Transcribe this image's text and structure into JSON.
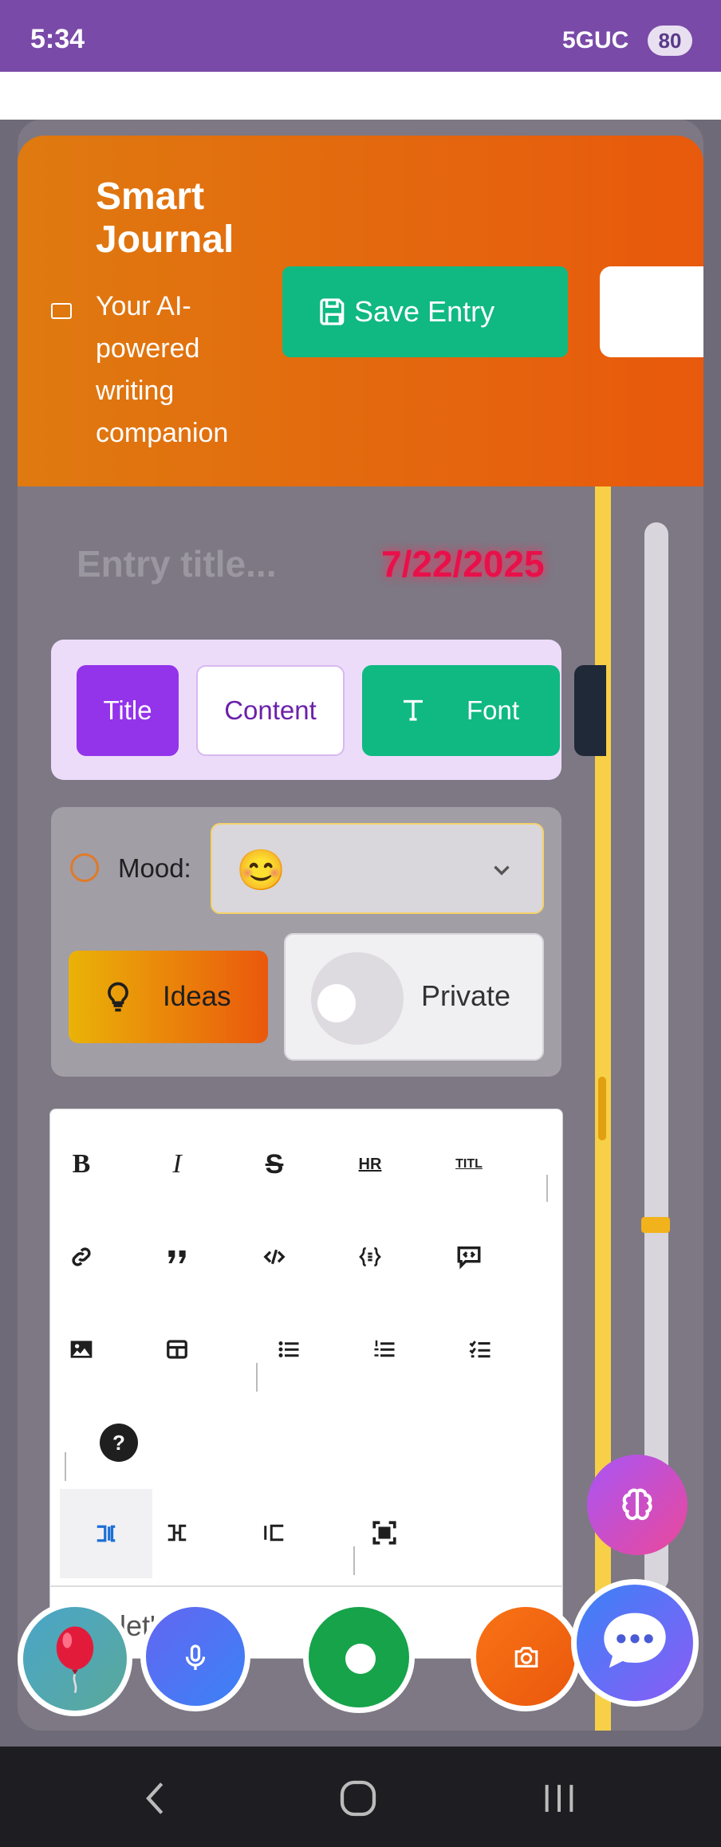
{
  "status_bar": {
    "time": "5:34",
    "network": "5GUC",
    "battery": "80"
  },
  "header": {
    "title": "Smart Journal",
    "subtitle": "Your AI-powered writing companion",
    "save_button_label": "Save Entry"
  },
  "entry": {
    "title_placeholder": "Entry title...",
    "date": "7/22/2025"
  },
  "tabs": [
    {
      "label": "Title"
    },
    {
      "label": "Content"
    },
    {
      "label": "Font"
    }
  ],
  "mood": {
    "label": "Mood:",
    "selected": "😊"
  },
  "ideas_button_label": "Ideas",
  "private_label": "Private",
  "private_enabled": false,
  "toolbar": {
    "bold": "B",
    "italic": "I",
    "strikethrough": "S",
    "hr": "HR",
    "title": "TITL",
    "help": "?"
  },
  "editor_preview": "let's g",
  "colors": {
    "accent": "#9333ea",
    "header_start": "#df7a10",
    "header_end": "#e8590c",
    "save": "#10b981",
    "date": "#e8104a"
  },
  "icons": [
    "book-icon",
    "save-icon",
    "font-icon",
    "smiley-icon",
    "chevron-down-icon",
    "lightbulb-icon",
    "brain-icon",
    "balloon-icon",
    "mic-icon",
    "camera-icon",
    "chat-icon",
    "back-icon",
    "home-icon",
    "recents-icon"
  ]
}
